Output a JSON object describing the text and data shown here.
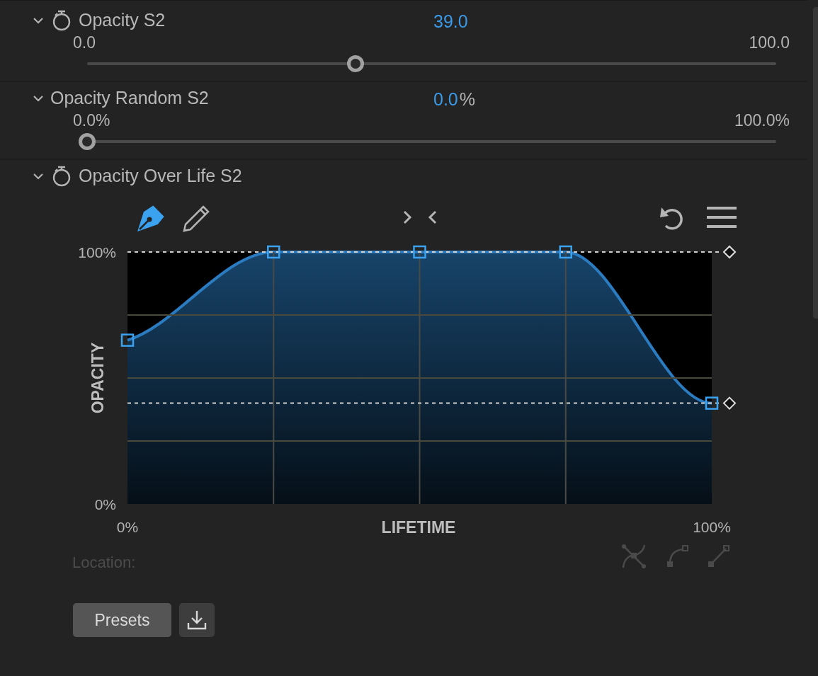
{
  "sections": [
    {
      "kind": "slider",
      "title": "Opacity S2",
      "expanded": true,
      "stopwatch": true,
      "value": "39.0",
      "min_label": "0.0",
      "max_label": "100.0",
      "level": 0.39
    },
    {
      "kind": "slider",
      "title": "Opacity Random S2",
      "expanded": true,
      "stopwatch": false,
      "value": "0.0",
      "unit": "%",
      "min_label": "0.0%",
      "max_label": "100.0%",
      "level": 0
    },
    {
      "kind": "curve",
      "title": "Opacity Over Life S2",
      "expanded": true,
      "stopwatch": true,
      "tools": [
        {
          "kind": "pen",
          "selected": true
        },
        {
          "kind": "pencil",
          "selected": false
        }
      ],
      "chart_data": {
        "type": "area",
        "xlabel": "LIFETIME",
        "ylabel": "OPACITY",
        "x": [
          0,
          25,
          50,
          75,
          100
        ],
        "series": [
          {
            "color": "#2a7bc0",
            "values": [
              65,
              100,
              100,
              100,
              40
            ]
          }
        ],
        "ref_lines": [
          {
            "axis": "y",
            "value": 100
          },
          {
            "axis": "y",
            "value": 40
          }
        ],
        "xlim": [
          0,
          100
        ],
        "ylim": [
          0,
          100
        ],
        "xticks": [
          {
            "value": 0,
            "label": "0%"
          },
          {
            "value": 100,
            "label": "100%"
          }
        ],
        "yticks": [
          {
            "value": 0,
            "label": "0%"
          },
          {
            "value": 100,
            "label": "100%"
          }
        ]
      },
      "location_label": "Location:",
      "presets_button": "Presets"
    }
  ]
}
